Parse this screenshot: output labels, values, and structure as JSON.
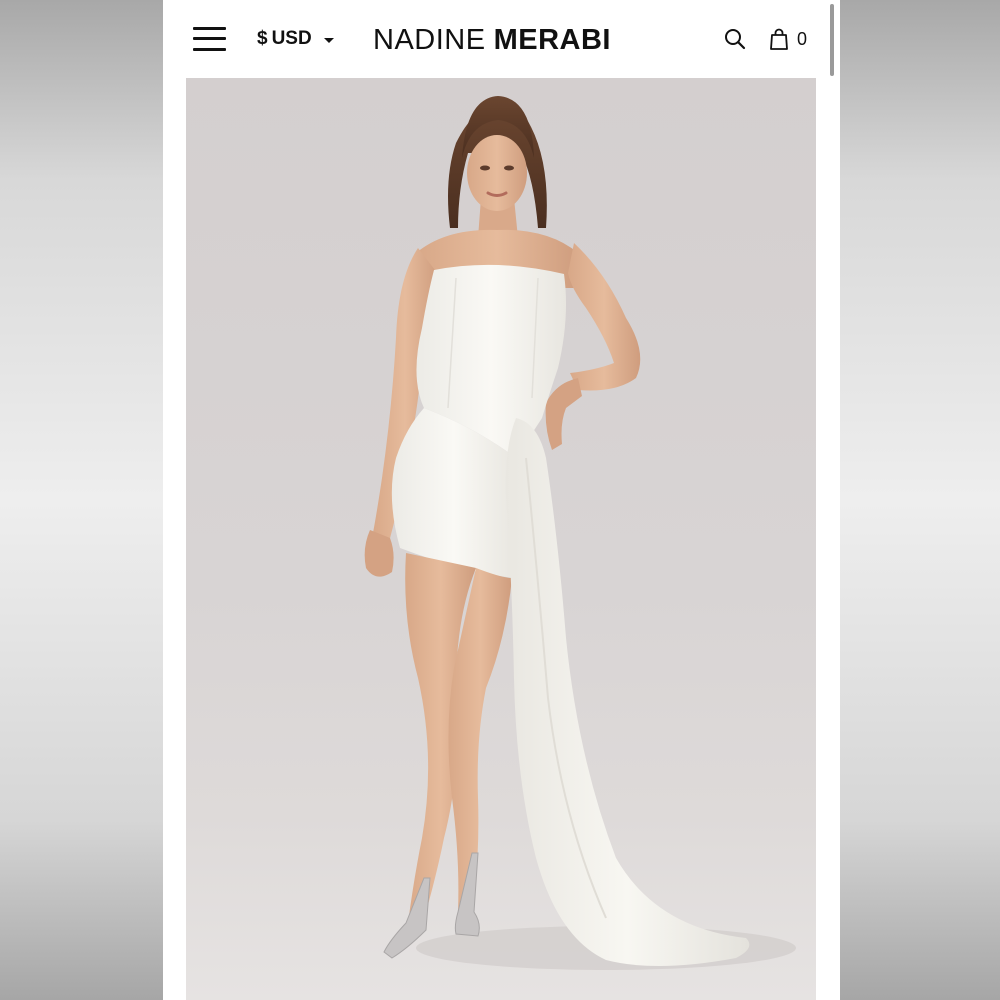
{
  "header": {
    "currency": {
      "symbol": "$",
      "code": "USD"
    },
    "brand": {
      "first": "NADINE",
      "second": "MERABI"
    },
    "cart_count": "0"
  },
  "icons": {
    "menu": "hamburger-menu-icon",
    "currency_caret": "chevron-down-icon",
    "search": "search-icon",
    "cart": "shopping-bag-icon"
  },
  "hero": {
    "subject": "model in white strapless mini dress with draped side train and silver strappy heels"
  },
  "colors": {
    "header_bg": "#ffffff",
    "text": "#111111",
    "hero_bg": "#d6d1d0",
    "dress": "#f6f4ef"
  }
}
